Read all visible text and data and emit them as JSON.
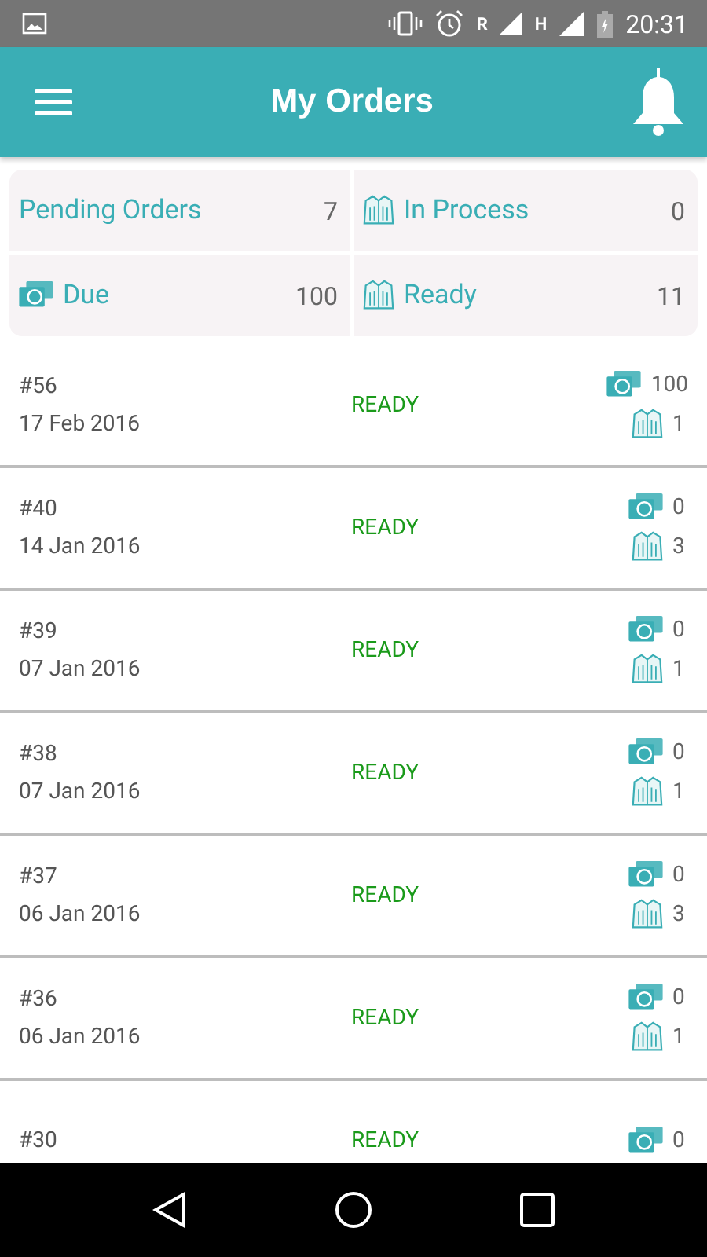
{
  "status_bar": {
    "roaming": "R",
    "network": "H",
    "time": "20:31"
  },
  "app_bar": {
    "title": "My Orders"
  },
  "summary": [
    {
      "label": "Pending Orders",
      "value": "7",
      "kind": "plain"
    },
    {
      "label": "In Process",
      "value": "0",
      "kind": "garment"
    },
    {
      "label": "Due",
      "value": "100",
      "kind": "money"
    },
    {
      "label": "Ready",
      "value": "11",
      "kind": "garment"
    }
  ],
  "orders": [
    {
      "number": "#56",
      "date": "17 Feb 2016",
      "status": "READY",
      "due": "100",
      "items": "1"
    },
    {
      "number": "#40",
      "date": "14 Jan 2016",
      "status": "READY",
      "due": "0",
      "items": "3"
    },
    {
      "number": "#39",
      "date": "07 Jan 2016",
      "status": "READY",
      "due": "0",
      "items": "1"
    },
    {
      "number": "#38",
      "date": "07 Jan 2016",
      "status": "READY",
      "due": "0",
      "items": "1"
    },
    {
      "number": "#37",
      "date": "06 Jan 2016",
      "status": "READY",
      "due": "0",
      "items": "3"
    },
    {
      "number": "#36",
      "date": "06 Jan 2016",
      "status": "READY",
      "due": "0",
      "items": "1"
    },
    {
      "number": "#30",
      "status": "READY",
      "due": "0"
    }
  ]
}
